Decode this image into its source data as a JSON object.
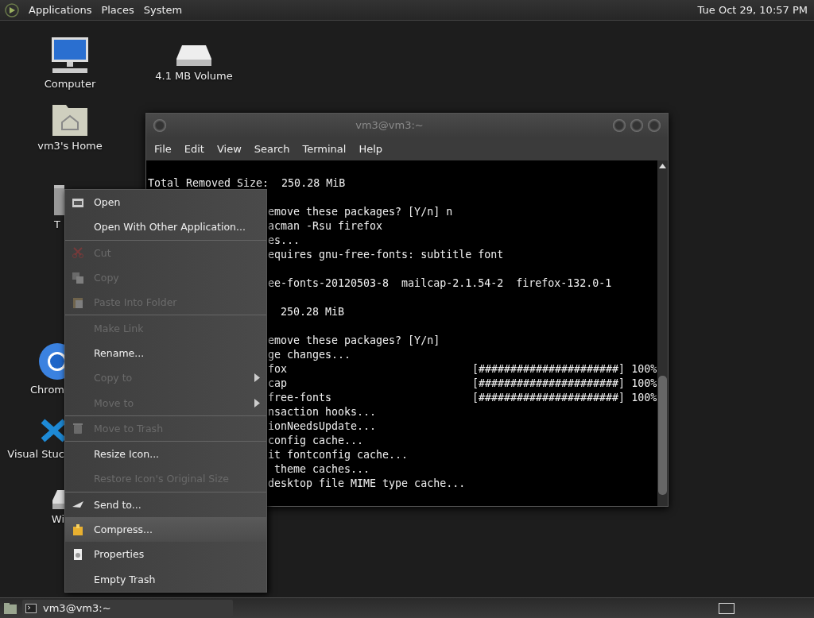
{
  "top_panel": {
    "menus": [
      "Applications",
      "Places",
      "System"
    ],
    "clock": "Tue Oct 29, 10:57 PM"
  },
  "desktop_icons": [
    {
      "kind": "computer",
      "label": "Computer"
    },
    {
      "kind": "drive",
      "label": "4.1 MB Volume"
    },
    {
      "kind": "home",
      "label": "vm3's Home"
    },
    {
      "kind": "trash",
      "label": "T"
    },
    {
      "kind": "chrome",
      "label": "Chrom"
    },
    {
      "kind": "vscode",
      "label": "Visual Stuc"
    },
    {
      "kind": "disk",
      "label": "Wi"
    }
  ],
  "terminal": {
    "title": "vm3@vm3:~",
    "menus": [
      "File",
      "Edit",
      "View",
      "Search",
      "Terminal",
      "Help"
    ],
    "blocks": [
      {
        "kind": "whole",
        "lines": [
          {
            "text": "Total Removed Size:  250.28 MiB"
          }
        ]
      },
      {
        "kind": "clipped",
        "lines": [
          {
            "text": "emove these packages? [Y/n] n"
          },
          {
            "text": "acman -Rsu firefox"
          },
          {
            "text": "es..."
          },
          {
            "text": "equires gnu-free-fonts: subtitle font"
          }
        ]
      },
      {
        "kind": "clipped",
        "lines": [
          {
            "text": "ee-fonts-20120503-8  mailcap-2.1.54-2  firefox-132.0-1"
          }
        ]
      },
      {
        "kind": "clipped",
        "lines": [
          {
            "text": "  250.28 MiB"
          }
        ]
      },
      {
        "kind": "clipped",
        "lines": [
          {
            "text": "emove these packages? [Y/n]"
          },
          {
            "text": "ge changes..."
          },
          {
            "text": "fox",
            "bar": "[######################]",
            "percent": "100%"
          },
          {
            "text": "cap",
            "bar": "[######################]",
            "percent": "100%"
          },
          {
            "text": "free-fonts",
            "bar": "[######################]",
            "percent": "100%"
          },
          {
            "text": "nsaction hooks..."
          },
          {
            "text": "ionNeedsUpdate..."
          },
          {
            "text": "config cache..."
          },
          {
            "text": "it fontconfig cache..."
          },
          {
            "text": " theme caches..."
          },
          {
            "text": "desktop file MIME type cache..."
          }
        ]
      }
    ]
  },
  "context_menu": {
    "groups": [
      [
        {
          "label": "Open",
          "kind": "folder",
          "disabled": false,
          "submenu": false,
          "highlighted": false
        },
        {
          "label": "Open With Other Application...",
          "kind": "plain",
          "disabled": false,
          "submenu": false,
          "highlighted": false
        }
      ],
      [
        {
          "label": "Cut",
          "kind": "scissors",
          "disabled": true,
          "submenu": false,
          "highlighted": false
        },
        {
          "label": "Copy",
          "kind": "copy",
          "disabled": true,
          "submenu": false,
          "highlighted": false
        },
        {
          "label": "Paste Into Folder",
          "kind": "paste",
          "disabled": true,
          "submenu": false,
          "highlighted": false
        }
      ],
      [
        {
          "label": "Make Link",
          "kind": "plain",
          "disabled": true,
          "submenu": false,
          "highlighted": false
        },
        {
          "label": "Rename...",
          "kind": "plain",
          "disabled": false,
          "submenu": false,
          "highlighted": false
        },
        {
          "label": "Copy to",
          "kind": "plain",
          "disabled": true,
          "submenu": true,
          "highlighted": false
        },
        {
          "label": "Move to",
          "kind": "plain",
          "disabled": true,
          "submenu": true,
          "highlighted": false
        }
      ],
      [
        {
          "label": "Move to Trash",
          "kind": "trash",
          "disabled": true,
          "submenu": false,
          "highlighted": false
        }
      ],
      [
        {
          "label": "Resize Icon...",
          "kind": "plain",
          "disabled": false,
          "submenu": false,
          "highlighted": false
        },
        {
          "label": "Restore Icon's Original Size",
          "kind": "plain",
          "disabled": true,
          "submenu": false,
          "highlighted": false
        }
      ],
      [
        {
          "label": "Send to...",
          "kind": "send",
          "disabled": false,
          "submenu": false,
          "highlighted": false
        },
        {
          "label": "Compress...",
          "kind": "package",
          "disabled": false,
          "submenu": false,
          "highlighted": true
        },
        {
          "label": "Properties",
          "kind": "document",
          "disabled": false,
          "submenu": false,
          "highlighted": false
        },
        {
          "label": "Empty Trash",
          "kind": "plain",
          "disabled": false,
          "submenu": false,
          "highlighted": false
        }
      ]
    ]
  },
  "bottom_panel": {
    "tasks": [
      {
        "label": "vm3@vm3:~",
        "selected": false
      }
    ]
  }
}
